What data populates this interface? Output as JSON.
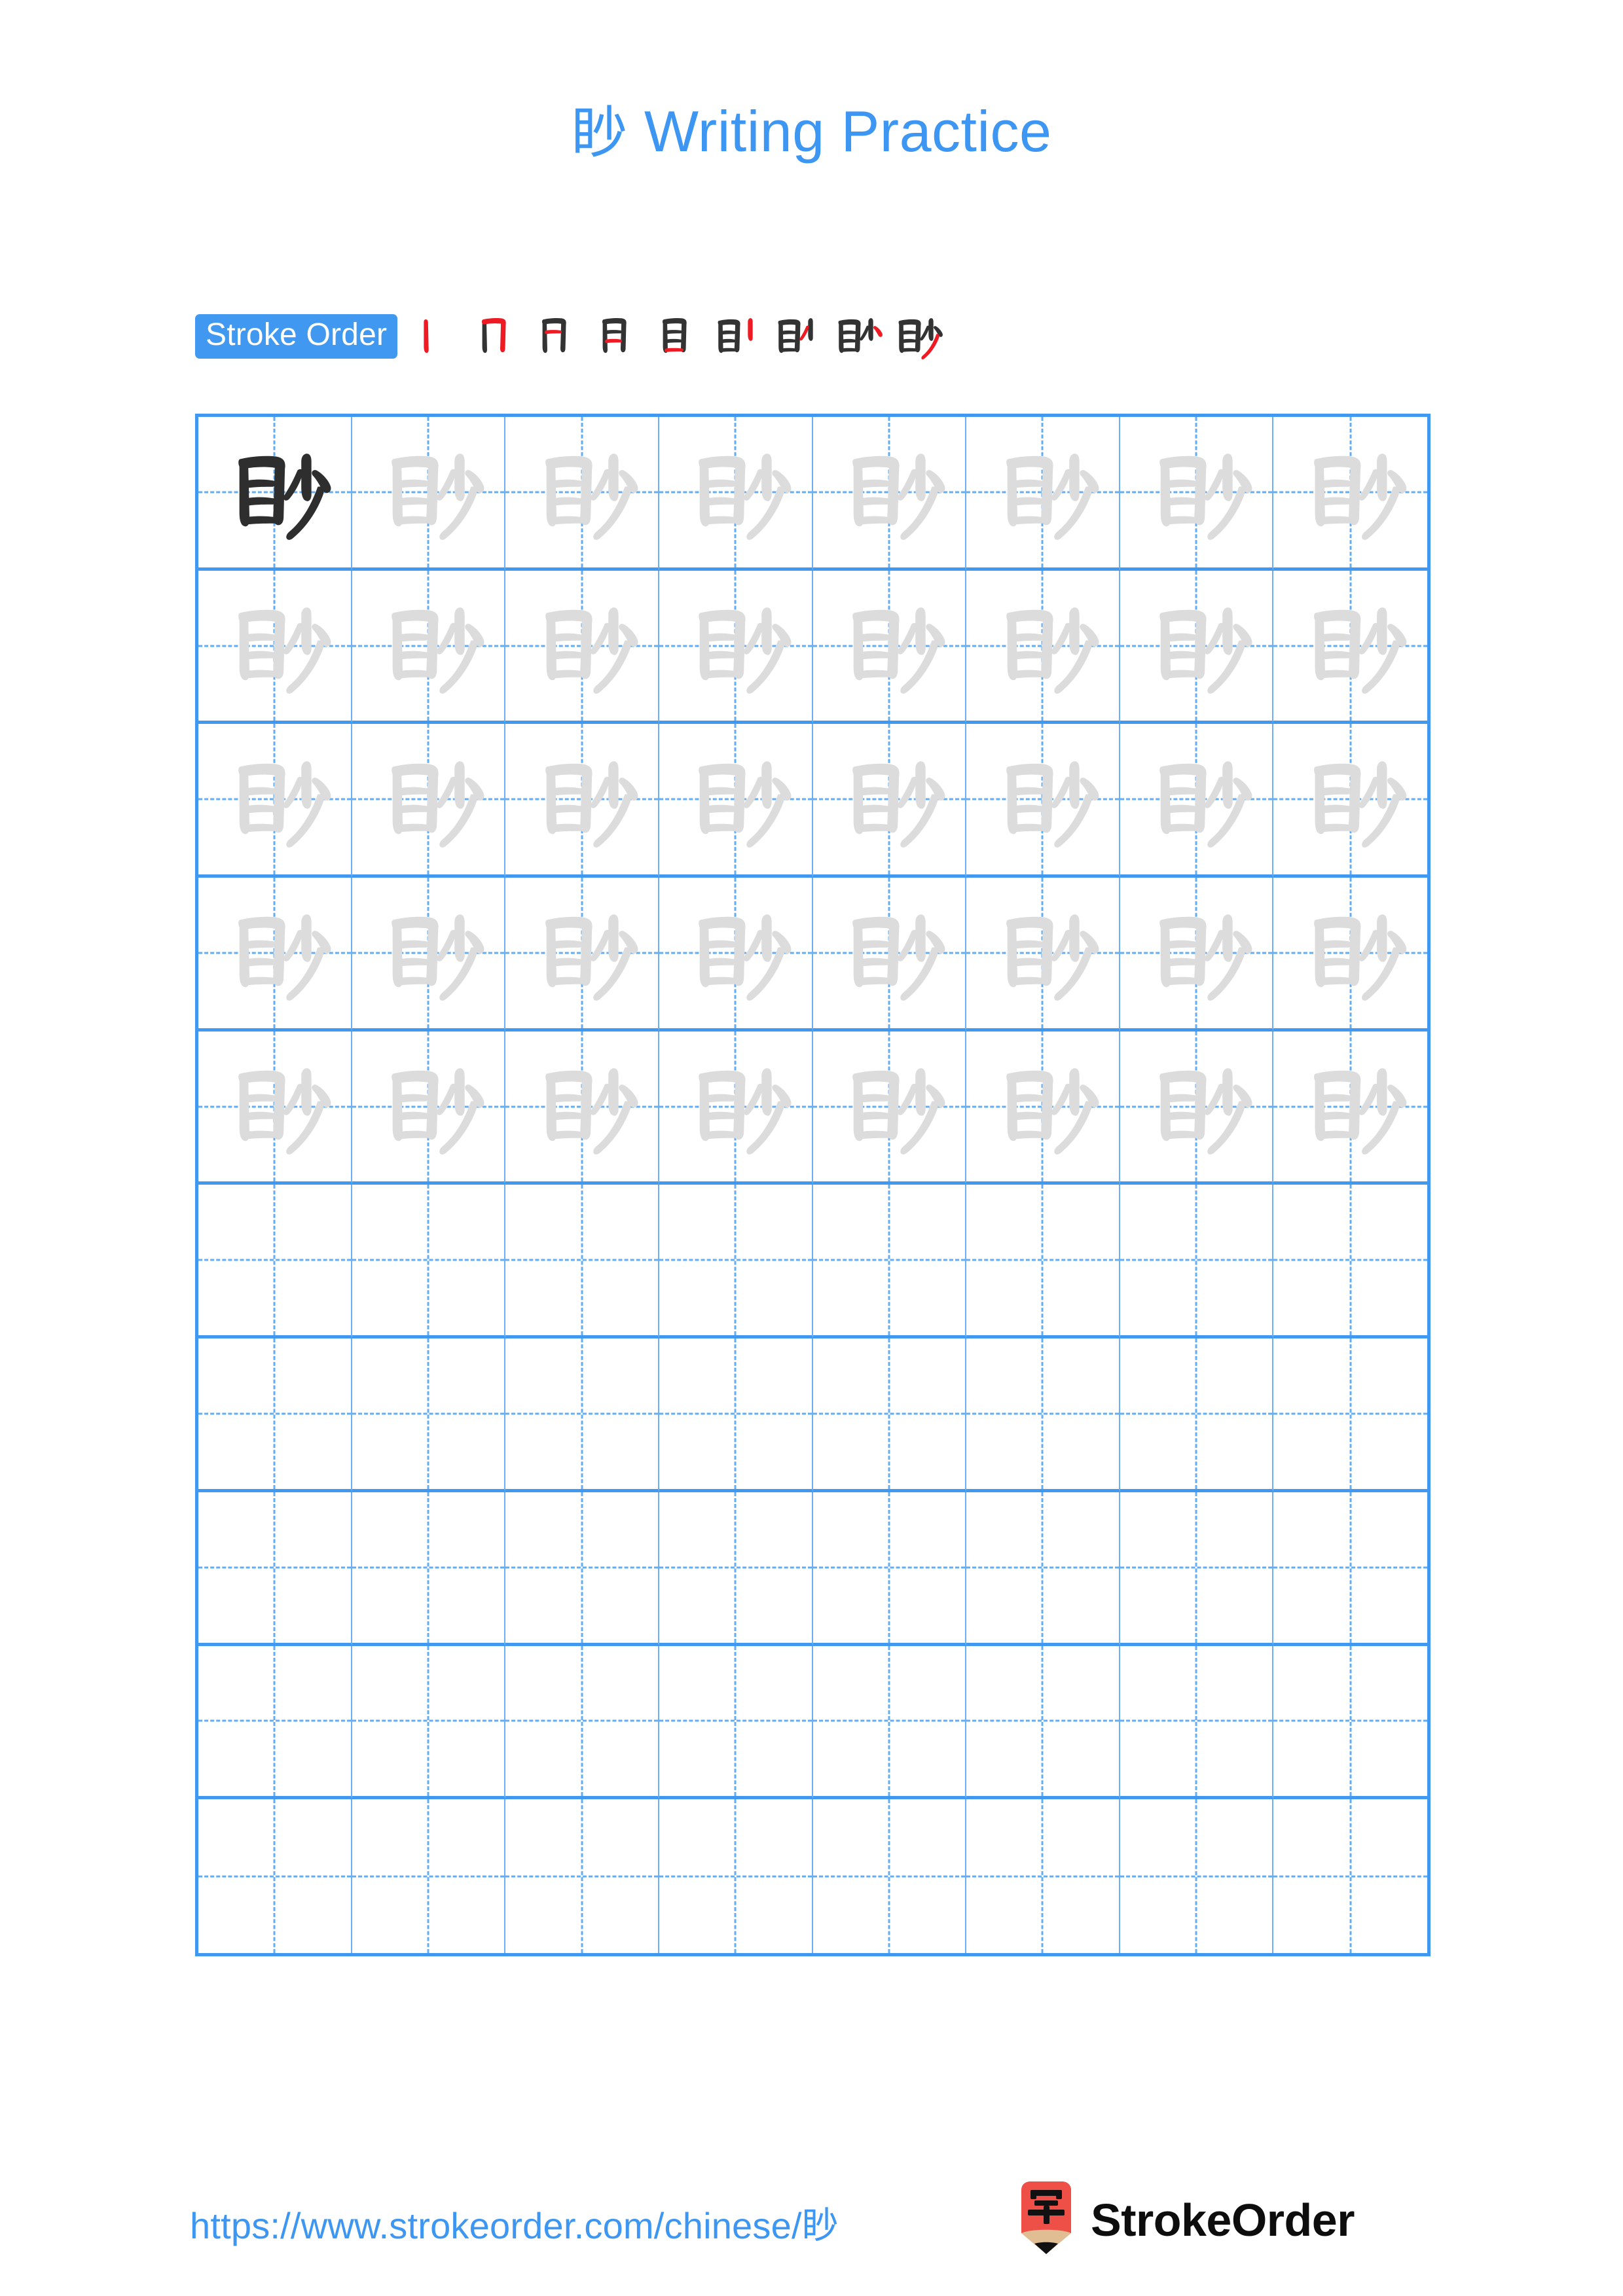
{
  "document": {
    "character": "眇",
    "title_suffix": " Writing Practice",
    "title_full": "眇 Writing Practice",
    "page_background": "#ffffff"
  },
  "colors": {
    "accent_blue": "#3D97F2",
    "badge_blue": "#4098F0",
    "grid_border": "#4098F0",
    "grid_line": "#6BB0F4",
    "grid_dashed": "#63ADF3",
    "char_dark": "#2E2E2E",
    "char_trace": "#DCDCDC",
    "stroke_new_red": "#EE1B24",
    "stroke_old_black": "#333333",
    "logo_red": "#EE4F47",
    "logo_wood": "#E0BD92",
    "logo_tip": "#111111"
  },
  "stroke_order": {
    "badge_label": "Stroke Order",
    "total_strokes": 9,
    "steps": [
      {
        "index": 1,
        "strokes_drawn": 1,
        "new_stroke_name": "shu"
      },
      {
        "index": 2,
        "strokes_drawn": 2,
        "new_stroke_name": "heng-zhe-gou"
      },
      {
        "index": 3,
        "strokes_drawn": 3,
        "new_stroke_name": "heng"
      },
      {
        "index": 4,
        "strokes_drawn": 4,
        "new_stroke_name": "heng"
      },
      {
        "index": 5,
        "strokes_drawn": 5,
        "new_stroke_name": "heng"
      },
      {
        "index": 6,
        "strokes_drawn": 6,
        "new_stroke_name": "shu"
      },
      {
        "index": 7,
        "strokes_drawn": 7,
        "new_stroke_name": "pie"
      },
      {
        "index": 8,
        "strokes_drawn": 8,
        "new_stroke_name": "dian"
      },
      {
        "index": 9,
        "strokes_drawn": 9,
        "new_stroke_name": "pie"
      }
    ]
  },
  "practice_grid": {
    "columns": 8,
    "rows": 10,
    "rows_with_characters": 5,
    "first_cell_style": "dark",
    "other_filled_cell_style": "trace",
    "empty_rows": 5
  },
  "footer": {
    "url_text": "https://www.strokeorder.com/chinese/眇",
    "brand_name": "StrokeOrder",
    "logo_character": "字"
  }
}
